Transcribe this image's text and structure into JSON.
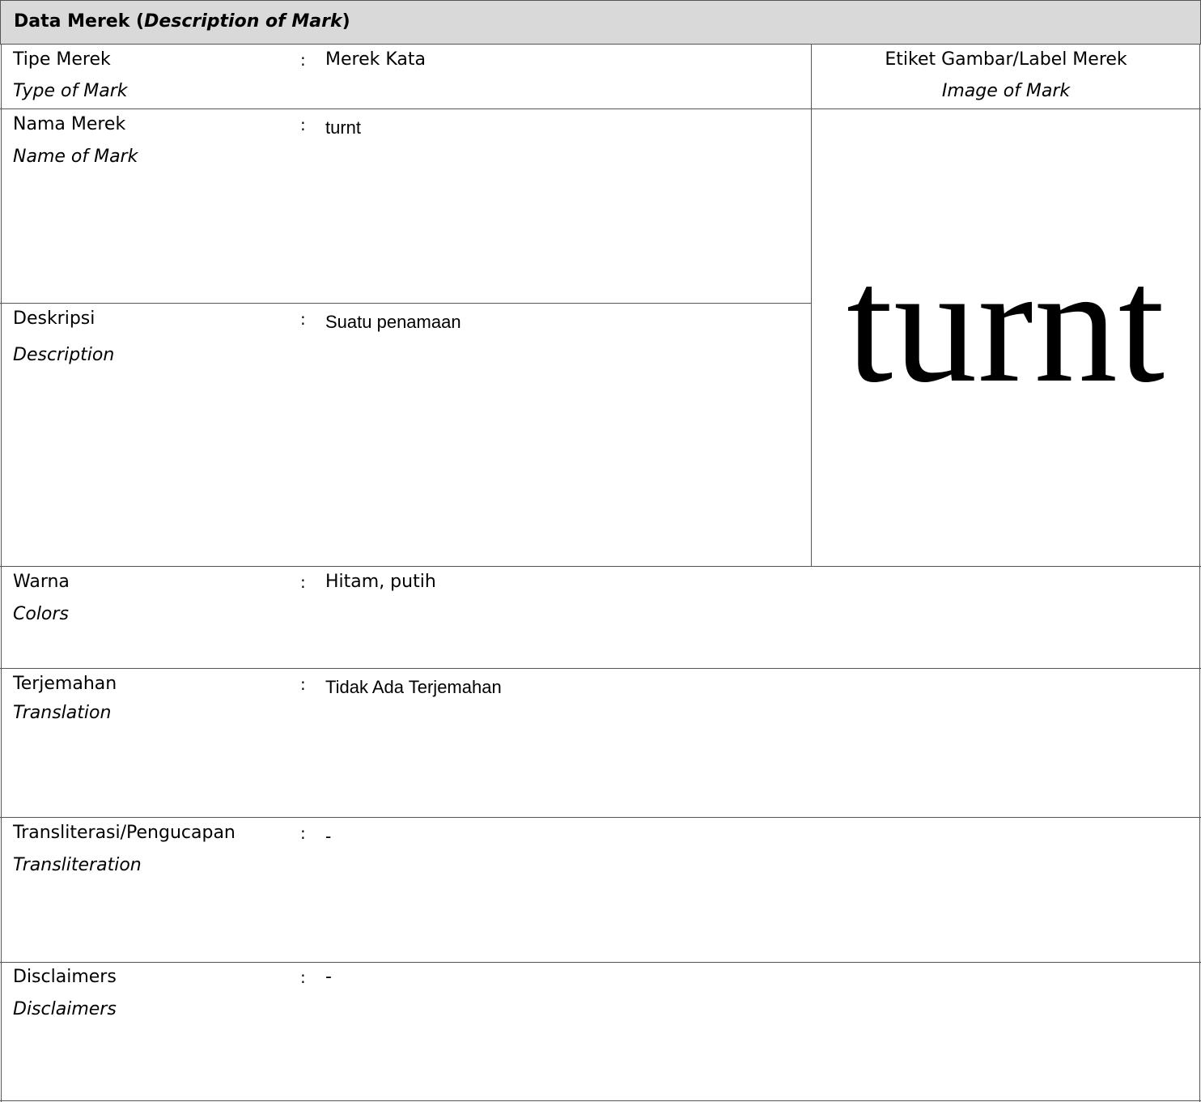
{
  "header": {
    "title_main": "Data Merek (",
    "title_italic": "Description of Mark",
    "title_end": ")"
  },
  "fields": {
    "type": {
      "label": "Tipe Merek",
      "label_en": "Type of Mark",
      "value": "Merek Kata"
    },
    "name": {
      "label": "Nama Merek",
      "label_en": "Name of Mark",
      "value": "turnt"
    },
    "description": {
      "label": "Deskripsi",
      "label_en": "Description",
      "value": "Suatu penamaan"
    },
    "colors": {
      "label": "Warna",
      "label_en": "Colors",
      "value": "Hitam, putih"
    },
    "translation": {
      "label": "Terjemahan",
      "label_en": "Translation",
      "value": "Tidak Ada Terjemahan"
    },
    "transliteration": {
      "label": "Transliterasi/Pengucapan",
      "label_en": "Transliteration",
      "value": "-"
    },
    "disclaimers": {
      "label": "Disclaimers",
      "label_en": "Disclaimers",
      "value": "-"
    }
  },
  "separator": ":",
  "image_panel": {
    "label": "Etiket Gambar/Label Merek",
    "label_en": "Image of Mark",
    "mark_text": "turnt"
  }
}
